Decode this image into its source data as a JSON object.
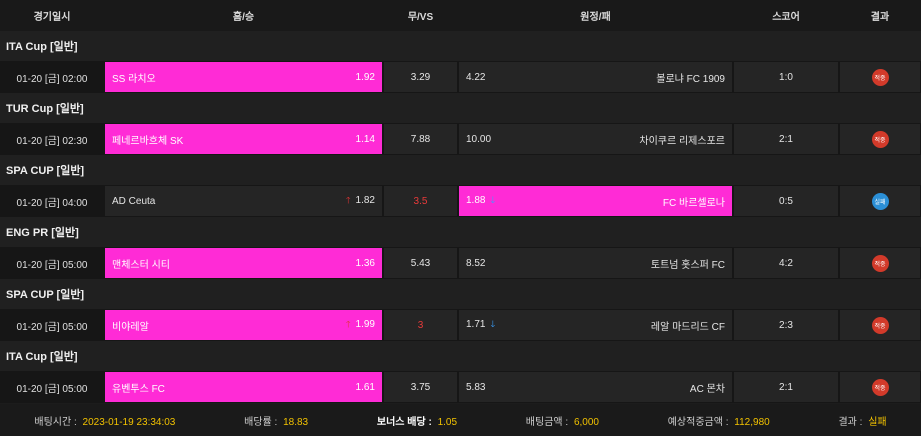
{
  "header": {
    "date": "경기일시",
    "home": "홈/승",
    "draw": "무/VS",
    "away": "원정/패",
    "score": "스코어",
    "result": "결과"
  },
  "groups": [
    {
      "league": "ITA Cup [일반]",
      "date": "01-20 [금] 02:00",
      "home": "SS 라치오",
      "home_odds": "1.92",
      "draw": "3.29",
      "away_odds": "4.22",
      "away": "볼로냐 FC 1909",
      "score": "1:0",
      "result": "적중"
    },
    {
      "league": "TUR Cup [일반]",
      "date": "01-20 [금] 02:30",
      "home": "페네르바흐체 SK",
      "home_odds": "1.14",
      "draw": "7.88",
      "away_odds": "10.00",
      "away": "차이쿠르 리제스포르",
      "score": "2:1",
      "result": "적중"
    },
    {
      "league": "SPA CUP [일반]",
      "date": "01-20 [금] 04:00",
      "home": "AD Ceuta",
      "home_odds": "1.82",
      "draw": "3.5",
      "away_odds": "1.88",
      "away": "FC 바르셀로나",
      "score": "0:5",
      "result": "실패"
    },
    {
      "league": "ENG PR [일반]",
      "date": "01-20 [금] 05:00",
      "home": "맨체스터 시티",
      "home_odds": "1.36",
      "draw": "5.43",
      "away_odds": "8.52",
      "away": "토트넘 홋스퍼 FC",
      "score": "4:2",
      "result": "적중"
    },
    {
      "league": "SPA CUP [일반]",
      "date": "01-20 [금] 05:00",
      "home": "비야레알",
      "home_odds": "1.99",
      "draw": "3",
      "away_odds": "1.71",
      "away": "레알 마드리드 CF",
      "score": "2:3",
      "result": "적중"
    },
    {
      "league": "ITA Cup [일반]",
      "date": "01-20 [금] 05:00",
      "home": "유벤투스 FC",
      "home_odds": "1.61",
      "draw": "3.75",
      "away_odds": "5.83",
      "away": "AC 몬차",
      "score": "2:1",
      "result": "적중"
    }
  ],
  "footer": {
    "bet_time_label": "배팅시간 :",
    "bet_time": "2023-01-19 23:34:03",
    "odds_label": "배당률 :",
    "odds": "18.83",
    "bonus_label": "보너스 배당 :",
    "bonus": "1.05",
    "amount_label": "배팅금액 :",
    "amount": "6,000",
    "expected_label": "예상적중금액 :",
    "expected": "112,980",
    "result_label": "결과 :",
    "result": "실패"
  },
  "colors": {
    "highlight": "#ff2bd6",
    "hit": "#d23a2a",
    "miss": "#2b8fd6",
    "accent": "#f2c200"
  }
}
